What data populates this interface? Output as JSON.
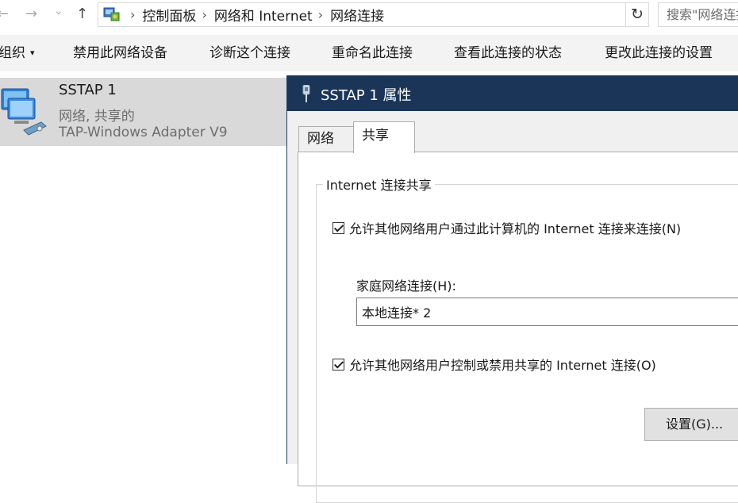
{
  "nav": {
    "back_glyph": "←",
    "forward_glyph": "→",
    "recent_glyph": "⌄",
    "up_glyph": "↑",
    "breadcrumbs": [
      "控制面板",
      "网络和 Internet",
      "网络连接"
    ],
    "refresh_glyph": "↻",
    "dropdown_glyph": "⌄",
    "search_placeholder": "搜索\"网络连接\""
  },
  "toolbar": {
    "organize": "组织",
    "items": [
      "禁用此网络设备",
      "诊断这个连接",
      "重命名此连接",
      "查看此连接的状态",
      "更改此连接的设置"
    ]
  },
  "connection": {
    "name": "SSTAP 1",
    "status": "网络, 共享的",
    "adapter": "TAP-Windows Adapter V9"
  },
  "dialog": {
    "title": "SSTAP 1 属性",
    "tabs": [
      "网络",
      "共享"
    ],
    "group_label": "Internet 连接共享",
    "allow_share_label": "允许其他网络用户通过此计算机的 Internet 连接来连接(N)",
    "allow_share_checked": true,
    "home_network_label": "家庭网络连接(H):",
    "home_network_value": "本地连接* 2",
    "allow_control_label": "允许其他网络用户控制或禁用共享的 Internet 连接(O)",
    "allow_control_checked": true,
    "settings_button": "设置(G)..."
  },
  "colors": {
    "title_bar": "#1b3559",
    "command_bar": "#f3f3f3",
    "selected_item": "#d9d9d9"
  }
}
